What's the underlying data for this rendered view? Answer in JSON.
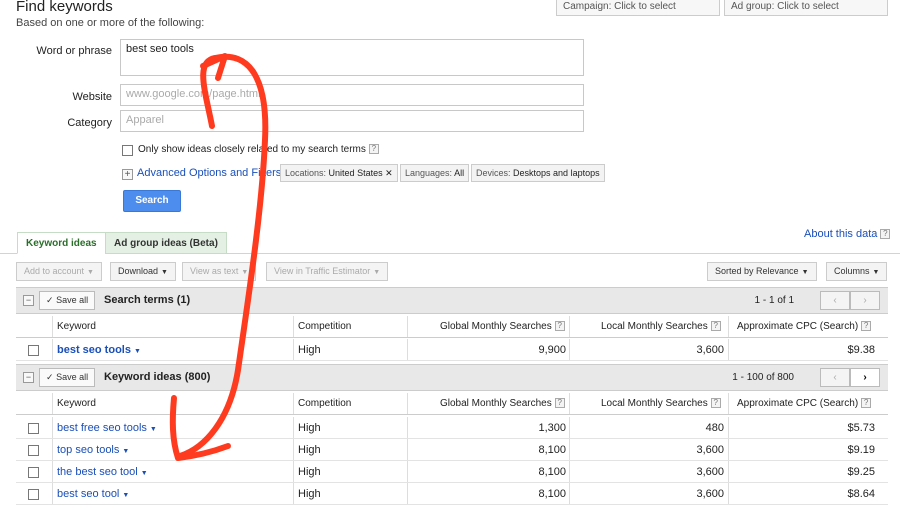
{
  "header": {
    "title": "Find keywords",
    "subtitle": "Based on one or more of the following:"
  },
  "selectors": {
    "campaign": "Campaign: Click to select",
    "ad_group": "Ad group: Click to select"
  },
  "form": {
    "word_label": "Word or phrase",
    "word_value": "best seo tools",
    "website_label": "Website",
    "website_placeholder": "www.google.com/page.html",
    "category_label": "Category",
    "category_placeholder": "Apparel",
    "only_show_label": "Only show ideas closely related to my search terms",
    "advanced_label": "Advanced Options and Filters",
    "location_key": "Locations:",
    "location_val": "United States",
    "language_key": "Languages:",
    "language_val": "All",
    "device_key": "Devices:",
    "device_val": "Desktops and laptops",
    "search_button": "Search"
  },
  "tabs": {
    "keyword_ideas": "Keyword ideas",
    "ad_group_ideas": "Ad group ideas (Beta)"
  },
  "about": "About this data",
  "toolbar": {
    "add_to_account": "Add to account",
    "download": "Download",
    "view_as_text": "View as text",
    "view_in_traffic": "View in Traffic Estimator",
    "sorted_by": "Sorted by Relevance",
    "columns": "Columns"
  },
  "columns": {
    "keyword": "Keyword",
    "competition": "Competition",
    "global": "Global Monthly Searches",
    "local": "Local Monthly Searches",
    "cpc": "Approximate CPC (Search)"
  },
  "search_terms": {
    "save_all": "Save all",
    "title": "Search terms (1)",
    "pager": "1 - 1 of 1",
    "rows": [
      {
        "keyword": "best seo tools",
        "competition": "High",
        "global": "9,900",
        "local": "3,600",
        "cpc": "$9.38"
      }
    ]
  },
  "keyword_ideas": {
    "save_all": "Save all",
    "title": "Keyword ideas (800)",
    "pager": "1 - 100 of 800",
    "rows": [
      {
        "keyword": "best free seo tools",
        "competition": "High",
        "global": "1,300",
        "local": "480",
        "cpc": "$5.73"
      },
      {
        "keyword": "top seo tools",
        "competition": "High",
        "global": "8,100",
        "local": "3,600",
        "cpc": "$9.19"
      },
      {
        "keyword": "the best seo tool",
        "competition": "High",
        "global": "8,100",
        "local": "3,600",
        "cpc": "$9.25"
      },
      {
        "keyword": "best seo tool",
        "competition": "High",
        "global": "8,100",
        "local": "3,600",
        "cpc": "$8.64"
      }
    ]
  },
  "colors": {
    "arrow": "#ff3b1f",
    "link": "#1a4fb8",
    "search_button": "#4d8ded"
  },
  "icons": [
    "help-icon",
    "chevron-down-icon",
    "plus-box-icon",
    "minus-box-icon",
    "checkmark-icon",
    "close-icon",
    "chevron-left-icon",
    "chevron-right-icon"
  ]
}
